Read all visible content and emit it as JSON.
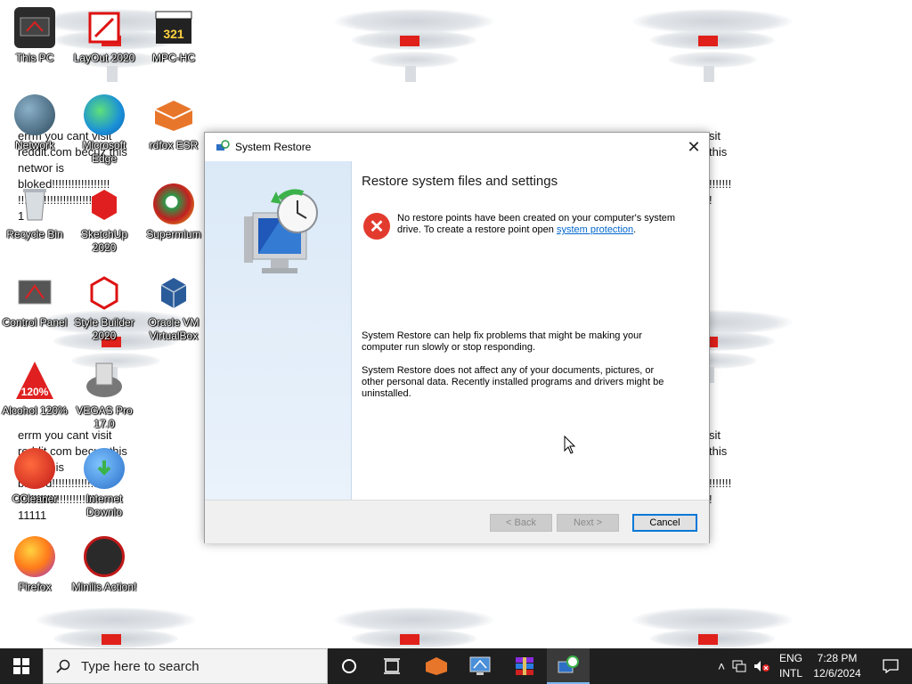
{
  "desktop": {
    "icons": [
      {
        "label": "This PC"
      },
      {
        "label": "LayOut 2020"
      },
      {
        "label": "MPC-HC"
      },
      {
        "label": "Network"
      },
      {
        "label": "Microsoft Edge"
      },
      {
        "label": "rdfox ESR"
      },
      {
        "label": "Recycle Bin"
      },
      {
        "label": "SketchUp 2020"
      },
      {
        "label": "Supermium"
      },
      {
        "label": "Control Panel"
      },
      {
        "label": "Style Builder 2020"
      },
      {
        "label": "Oracle VM VirtualBox"
      },
      {
        "label": "Alcohol 120%"
      },
      {
        "label": "VEGAS Pro 17.0"
      },
      {
        "label": "CCleaner"
      },
      {
        "label": "Internet Downlo"
      },
      {
        "label": "Firefox"
      },
      {
        "label": "Minilis Action!"
      }
    ],
    "wallpaper_text": {
      "block1": "errm you cant visit\nreddit.com becuz this\nnetwor is\nbloked!!!!!!!!!!!!!!!!!!\n!!!!!!!!!!!!!!!!!!!!!!!!\n1",
      "block2": "errm you cant visit\nreddit.com becuz this\nnetwor is\nbloked!!!!!!!!!!!!!!!!!!\n!!!!!!!!!!!!!!!!!!!!!!!!\n11111",
      "right1": "sit\nthis\n\n!!!!!!!\n!",
      "right2": "sit\nthis\n\n!!!!!!!\n!"
    }
  },
  "dialog": {
    "title": "System Restore",
    "heading": "Restore system files and settings",
    "error_text": "No restore points have been created on your computer's system drive. To create a restore point open ",
    "error_link": "system protection",
    "error_end": ".",
    "para1": "System Restore can help fix problems that might be making your computer run slowly or stop responding.",
    "para2": "System Restore does not affect any of your documents, pictures, or other personal data. Recently installed programs and drivers might be uninstalled.",
    "buttons": {
      "back": "< Back",
      "next": "Next >",
      "cancel": "Cancel"
    }
  },
  "taskbar": {
    "search_placeholder": "Type here to search",
    "lang_line1": "ENG",
    "lang_line2": "INTL",
    "time": "7:28 PM",
    "date": "12/6/2024"
  },
  "colors": {
    "accent": "#0078d7",
    "error": "#e23b2e",
    "taskbar": "#1f1f1f"
  }
}
